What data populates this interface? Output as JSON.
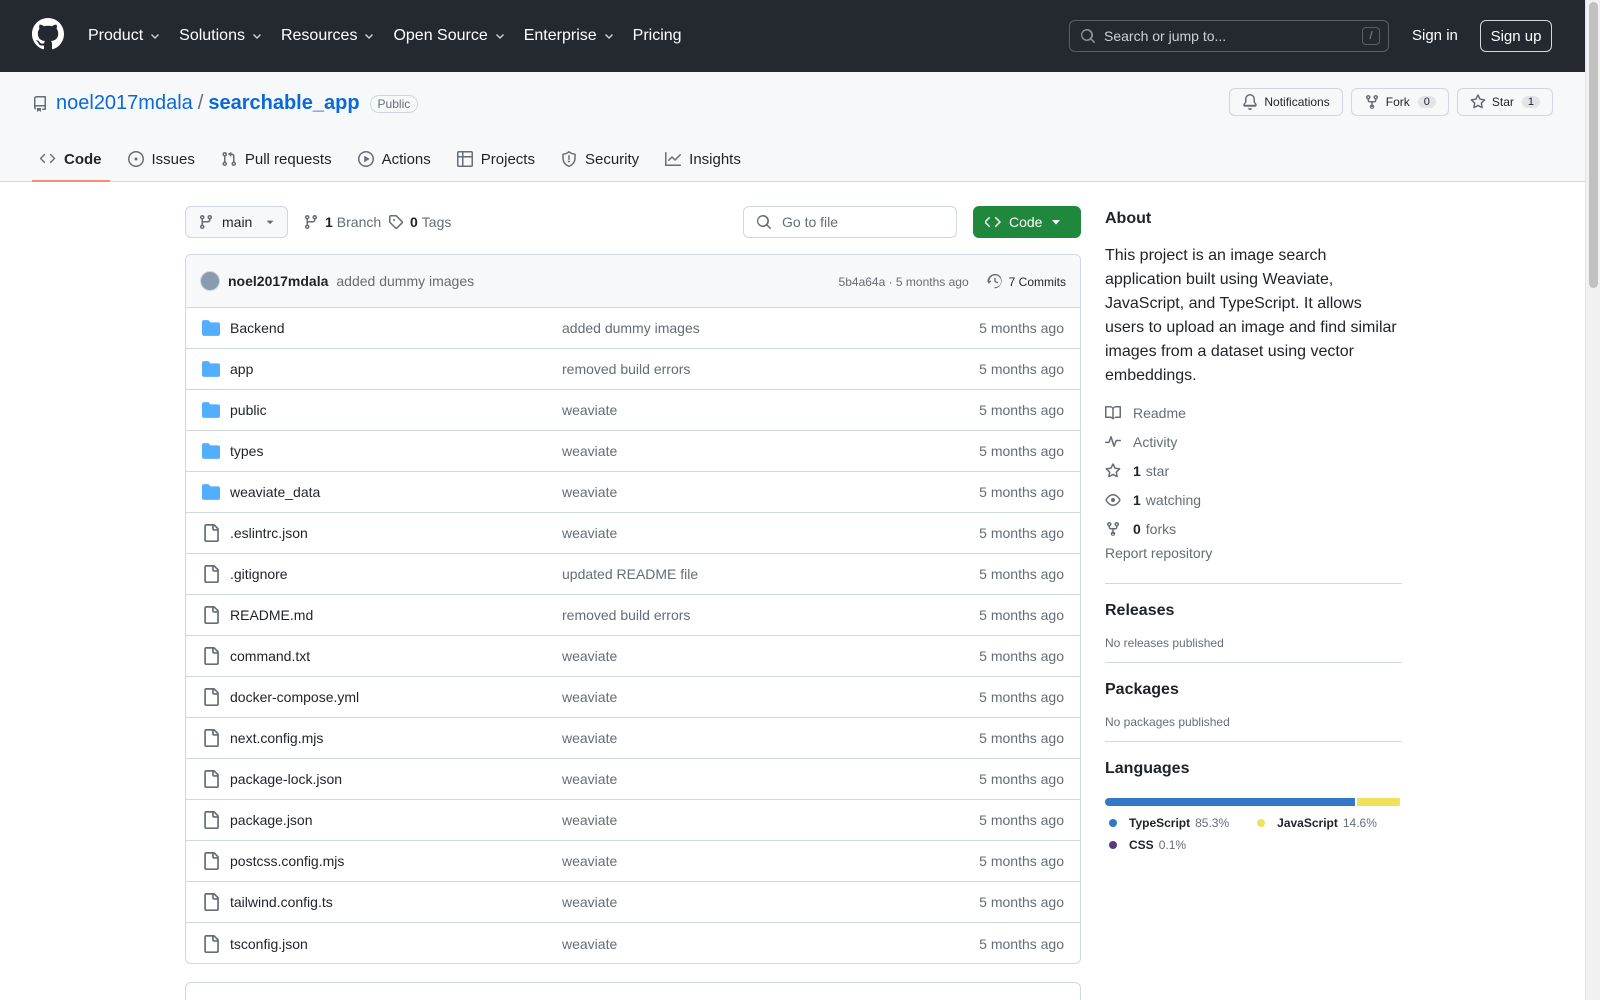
{
  "header": {
    "nav": [
      "Product",
      "Solutions",
      "Resources",
      "Open Source",
      "Enterprise",
      "Pricing"
    ],
    "nav_has_dropdown": [
      true,
      true,
      true,
      true,
      true,
      false
    ],
    "search_placeholder": "Search or jump to...",
    "search_shortcut": "/",
    "sign_in": "Sign in",
    "sign_up": "Sign up"
  },
  "repo": {
    "owner": "noel2017mdala",
    "separator": "/",
    "name": "searchable_app",
    "visibility": "Public",
    "notifications_label": "Notifications",
    "fork_label": "Fork",
    "fork_count": "0",
    "star_label": "Star",
    "star_count": "1"
  },
  "tabs": [
    {
      "label": "Code",
      "icon": "code-icon",
      "active": true
    },
    {
      "label": "Issues",
      "icon": "issue-icon",
      "active": false
    },
    {
      "label": "Pull requests",
      "icon": "pull-request-icon",
      "active": false
    },
    {
      "label": "Actions",
      "icon": "play-icon",
      "active": false
    },
    {
      "label": "Projects",
      "icon": "table-icon",
      "active": false
    },
    {
      "label": "Security",
      "icon": "shield-icon",
      "active": false
    },
    {
      "label": "Insights",
      "icon": "graph-icon",
      "active": false
    }
  ],
  "toolbar": {
    "branch": "main",
    "branch_count": "1",
    "branch_label": "Branch",
    "tag_count": "0",
    "tag_label": "Tags",
    "goto_placeholder": "Go to file",
    "code_label": "Code"
  },
  "commit": {
    "author": "noel2017mdala",
    "message": "added dummy images",
    "hash_time": "5b4a64a · 5 months ago",
    "commits_label": "7 Commits"
  },
  "files": [
    {
      "type": "dir",
      "name": "Backend",
      "message": "added dummy images",
      "date": "5 months ago"
    },
    {
      "type": "dir",
      "name": "app",
      "message": "removed build errors",
      "date": "5 months ago"
    },
    {
      "type": "dir",
      "name": "public",
      "message": "weaviate",
      "date": "5 months ago"
    },
    {
      "type": "dir",
      "name": "types",
      "message": "weaviate",
      "date": "5 months ago"
    },
    {
      "type": "dir",
      "name": "weaviate_data",
      "message": "weaviate",
      "date": "5 months ago"
    },
    {
      "type": "file",
      "name": ".eslintrc.json",
      "message": "weaviate",
      "date": "5 months ago"
    },
    {
      "type": "file",
      "name": ".gitignore",
      "message": "updated README file",
      "date": "5 months ago"
    },
    {
      "type": "file",
      "name": "README.md",
      "message": "removed build errors",
      "date": "5 months ago"
    },
    {
      "type": "file",
      "name": "command.txt",
      "message": "weaviate",
      "date": "5 months ago"
    },
    {
      "type": "file",
      "name": "docker-compose.yml",
      "message": "weaviate",
      "date": "5 months ago"
    },
    {
      "type": "file",
      "name": "next.config.mjs",
      "message": "weaviate",
      "date": "5 months ago"
    },
    {
      "type": "file",
      "name": "package-lock.json",
      "message": "weaviate",
      "date": "5 months ago"
    },
    {
      "type": "file",
      "name": "package.json",
      "message": "weaviate",
      "date": "5 months ago"
    },
    {
      "type": "file",
      "name": "postcss.config.mjs",
      "message": "weaviate",
      "date": "5 months ago"
    },
    {
      "type": "file",
      "name": "tailwind.config.ts",
      "message": "weaviate",
      "date": "5 months ago"
    },
    {
      "type": "file",
      "name": "tsconfig.json",
      "message": "weaviate",
      "date": "5 months ago"
    }
  ],
  "about": {
    "title": "About",
    "description": "This project is an image search application built using Weaviate, JavaScript, and TypeScript. It allows users to upload an image and find similar images from a dataset using vector embeddings.",
    "readme": "Readme",
    "activity": "Activity",
    "stars_count": "1",
    "stars_label": "star",
    "watching_count": "1",
    "watching_label": "watching",
    "forks_count": "0",
    "forks_label": "forks",
    "report": "Report repository"
  },
  "releases": {
    "title": "Releases",
    "empty": "No releases published"
  },
  "packages": {
    "title": "Packages",
    "empty": "No packages published"
  },
  "languages": {
    "title": "Languages",
    "items": [
      {
        "name": "TypeScript",
        "pct": "85.3%",
        "value": 85.3,
        "color": "#3178c6"
      },
      {
        "name": "JavaScript",
        "pct": "14.6%",
        "value": 14.6,
        "color": "#f1e05a"
      },
      {
        "name": "CSS",
        "pct": "0.1%",
        "value": 0.1,
        "color": "#563d7c"
      }
    ]
  },
  "colors": {
    "header_bg": "#24292f",
    "link": "#0969da",
    "code_button": "#1f883d",
    "active_tab_underline": "#fd8c73",
    "folder": "#54aeff"
  }
}
